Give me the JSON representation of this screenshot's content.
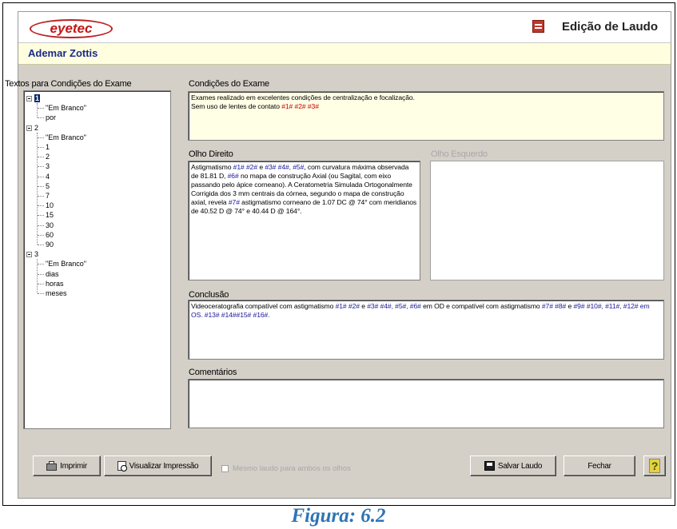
{
  "header": {
    "logo_text": "eyetec",
    "title": "Edição de Laudo",
    "title_icon": "report-icon"
  },
  "patient": {
    "name": "Ademar Zottis"
  },
  "left_panel": {
    "label": "Textos para Condições do Exame",
    "tree": [
      {
        "label": "1",
        "selected": true,
        "children": [
          "\"Em Branco\"",
          "por"
        ]
      },
      {
        "label": "2",
        "selected": false,
        "children": [
          "\"Em Branco\"",
          "1",
          "2",
          "3",
          "4",
          "5",
          "7",
          "10",
          "15",
          "30",
          "60",
          "90"
        ]
      },
      {
        "label": "3",
        "selected": false,
        "children": [
          "\"Em Branco\"",
          "dias",
          "horas",
          "meses"
        ]
      }
    ]
  },
  "condicoes": {
    "label": "Condições do Exame",
    "line1": "Exames realizado em excelentes condições de centralização e focalização.",
    "line2_prefix": "Sem uso de lentes de contato ",
    "line2_codes": "#1# #2# #3#"
  },
  "olho_direito": {
    "label": "Olho Direito",
    "text_parts": [
      {
        "t": "Astigmatismo ",
        "c": ""
      },
      {
        "t": "#1# #2#",
        "c": "blue"
      },
      {
        "t": " e ",
        "c": ""
      },
      {
        "t": "#3# #4#, #5#",
        "c": "blue"
      },
      {
        "t": ", com curvatura máxima observada de 81.81 D, ",
        "c": ""
      },
      {
        "t": "#6#",
        "c": "blue"
      },
      {
        "t": " no mapa de construção Axial (ou Sagital, com eixo passando pelo ápice corneano). A Ceratometria Simulada Ortogonalmente Corrigida dos 3 mm centrais da córnea, segundo o mapa de construção axial, revela ",
        "c": ""
      },
      {
        "t": "#7#",
        "c": "blue"
      },
      {
        "t": " astigmatismo corneano de 1.07 DC @ 74° com meridianos de 40.52 D @ 74° e 40.44 D @ 164°.",
        "c": ""
      }
    ]
  },
  "olho_esquerdo": {
    "label": "Olho Esquerdo"
  },
  "conclusao": {
    "label": "Conclusão",
    "text_parts": [
      {
        "t": "Videoceratografia compatível com astigmatismo ",
        "c": ""
      },
      {
        "t": "#1# #2#",
        "c": "blue"
      },
      {
        "t": " e ",
        "c": ""
      },
      {
        "t": "#3# #4#, #5#, #6#",
        "c": "blue"
      },
      {
        "t": " em OD e compatível com astigmatismo ",
        "c": ""
      },
      {
        "t": "#7# #8#",
        "c": "blue"
      },
      {
        "t": " e ",
        "c": ""
      },
      {
        "t": "#9# #10#, #11#, #12#",
        "c": "blue"
      },
      {
        "t": " em OS. #13# #14##15# #16#.",
        "c": "blue"
      }
    ]
  },
  "comentarios": {
    "label": "Comentários",
    "value": ""
  },
  "toolbar": {
    "print_label": "Imprimir",
    "preview_label": "Visualizar Impressão",
    "same_report_label": "Mesmo laudo para ambos os olhos",
    "save_label": "Salvar Laudo",
    "close_label": "Fechar",
    "help_label": "?"
  },
  "caption": "Figura: 6.2"
}
